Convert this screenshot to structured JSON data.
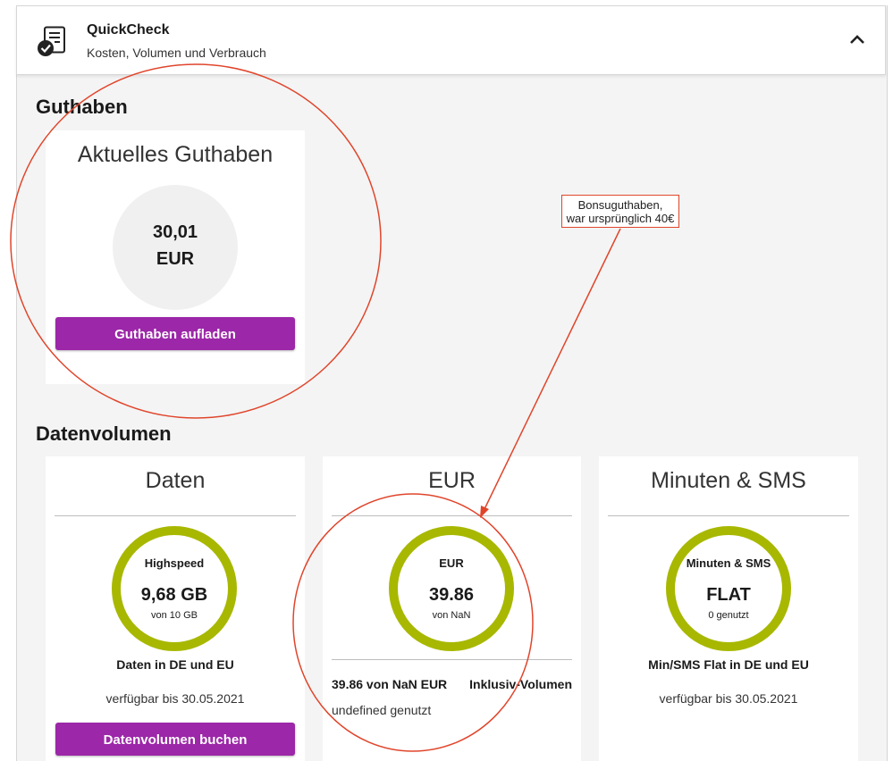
{
  "header": {
    "title": "QuickCheck",
    "subtitle": "Kosten, Volumen und Verbrauch",
    "icon": "checklist-icon",
    "chevron": "chevron-up-icon"
  },
  "guthaben": {
    "section_title": "Guthaben",
    "card_title": "Aktuelles Guthaben",
    "value": "30,01",
    "unit": "EUR",
    "button_label": "Guthaben aufladen"
  },
  "datenvolumen": {
    "section_title": "Datenvolumen",
    "cards": [
      {
        "title": "Daten",
        "ring_label": "Highspeed",
        "ring_value": "9,68 GB",
        "ring_sub": "von 10 GB",
        "caption": "Daten in DE und EU",
        "note": "verfügbar bis 30.05.2021",
        "button_label": "Datenvolumen buchen"
      },
      {
        "title": "EUR",
        "ring_label": "EUR",
        "ring_value": "39.86",
        "ring_sub": "von NaN",
        "detail_left": "39.86 von NaN EUR",
        "detail_right": "Inklusiv-Volumen",
        "used": "undefined genutzt"
      },
      {
        "title": "Minuten & SMS",
        "ring_label": "Minuten & SMS",
        "ring_value": "FLAT",
        "ring_sub": "0 genutzt",
        "caption": "Min/SMS Flat in DE und EU",
        "note": "verfügbar bis 30.05.2021"
      }
    ]
  },
  "annotation": {
    "line1": "Bonsuguthaben,",
    "line2": "war ursprünglich 40€"
  },
  "colors": {
    "accent": "#9c27a8",
    "ring": "#a8b800",
    "annotation": "#e0452b"
  }
}
